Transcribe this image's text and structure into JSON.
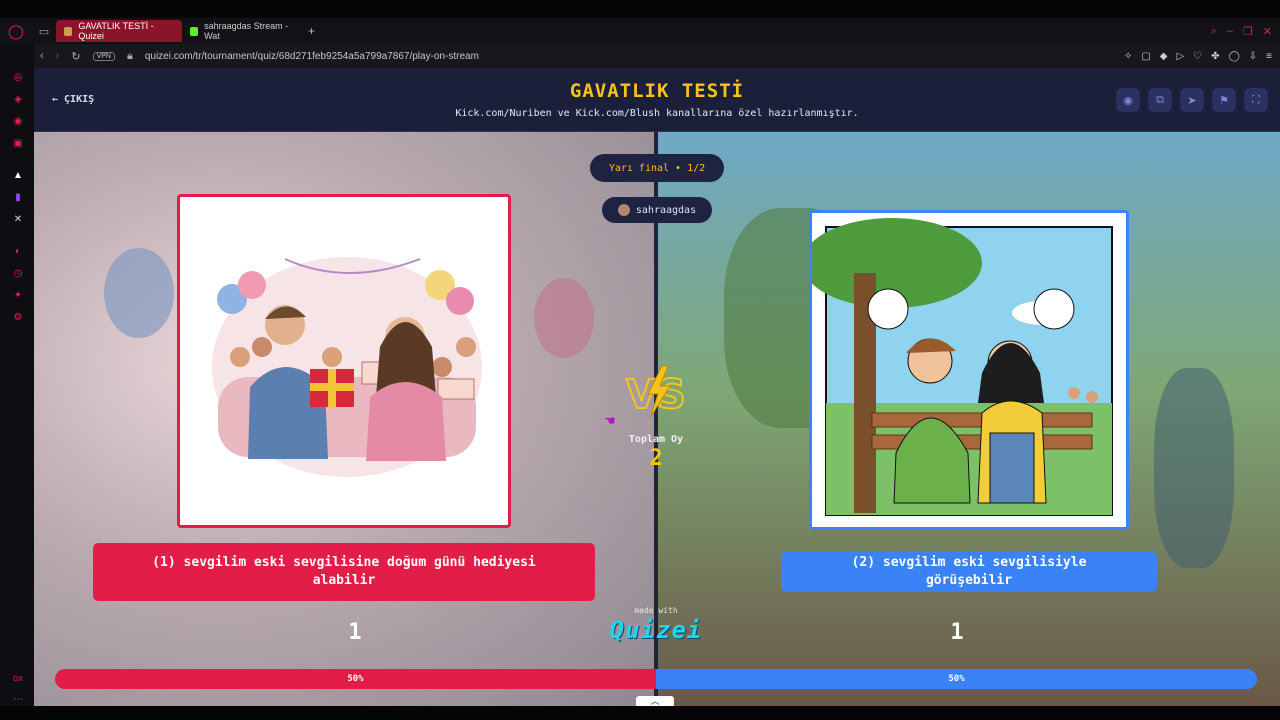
{
  "browser": {
    "tabs": [
      {
        "label": "GAVATLIK TESTİ - Quizei",
        "active": true
      },
      {
        "label": "sahraagdas Stream - Wat",
        "active": false
      }
    ],
    "url": "quizei.com/tr/tournament/quiz/68d271feb9254a5a799a7867/play-on-stream",
    "vpn_label": "VPN"
  },
  "header": {
    "exit_label": "ÇIKIŞ",
    "title": "GAVATLIK TESTİ",
    "subtitle": "Kick.com/Nuriben ve Kick.com/Blush kanallarına özel hazırlanmıştır.",
    "buttons": [
      "eye-icon",
      "copy-icon",
      "send-icon",
      "flag-icon",
      "fullscreen-icon"
    ]
  },
  "round": {
    "label": "Yarı final • 1/2",
    "streamer": "sahraagdas"
  },
  "options": {
    "left": {
      "text": "(1) sevgilim eski sevgilisine doğum günü hediyesi alabilir",
      "votes": "1",
      "percent_label": "50%",
      "percent": 50
    },
    "right": {
      "text": "(2) sevgilim eski sevgilisiyle görüşebilir",
      "votes": "1",
      "percent_label": "50%",
      "percent": 50
    }
  },
  "center": {
    "vs_label": "VS",
    "total_label": "Toplam Oy",
    "total_value": "2",
    "made_with": "made with",
    "brand": "Quizei"
  },
  "colors": {
    "left": "#e21d48",
    "right": "#3b82f6",
    "accent": "#f5c31a",
    "header_bg": "#1b1f3a"
  }
}
